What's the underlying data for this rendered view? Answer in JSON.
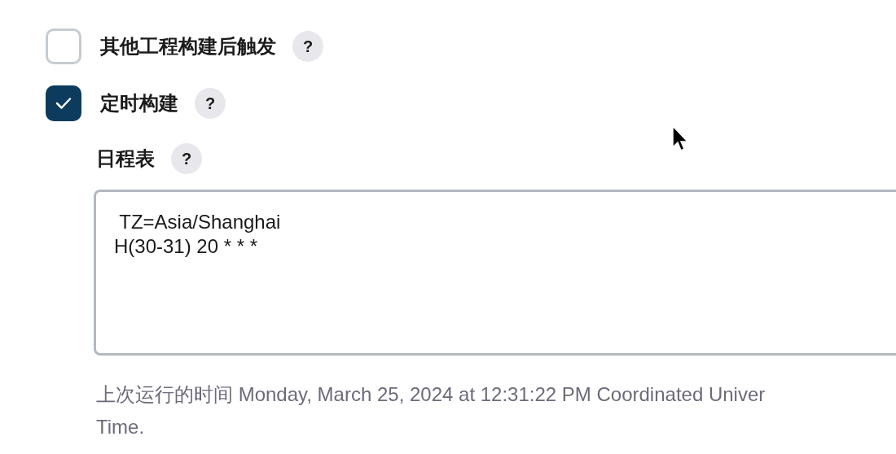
{
  "triggers": [
    {
      "label": "其他工程构建后触发",
      "checked": false,
      "help": "?"
    },
    {
      "label": "定时构建",
      "checked": true,
      "help": "?",
      "schedule": {
        "label": "日程表",
        "help": "?",
        "value": " TZ=Asia/Shanghai\nH(30-31) 20 * * *",
        "description_lines": [
          "上次运行的时间 Monday, March 25, 2024 at 12:31:22 PM Coordinated Univer",
          "Time."
        ]
      }
    }
  ]
}
